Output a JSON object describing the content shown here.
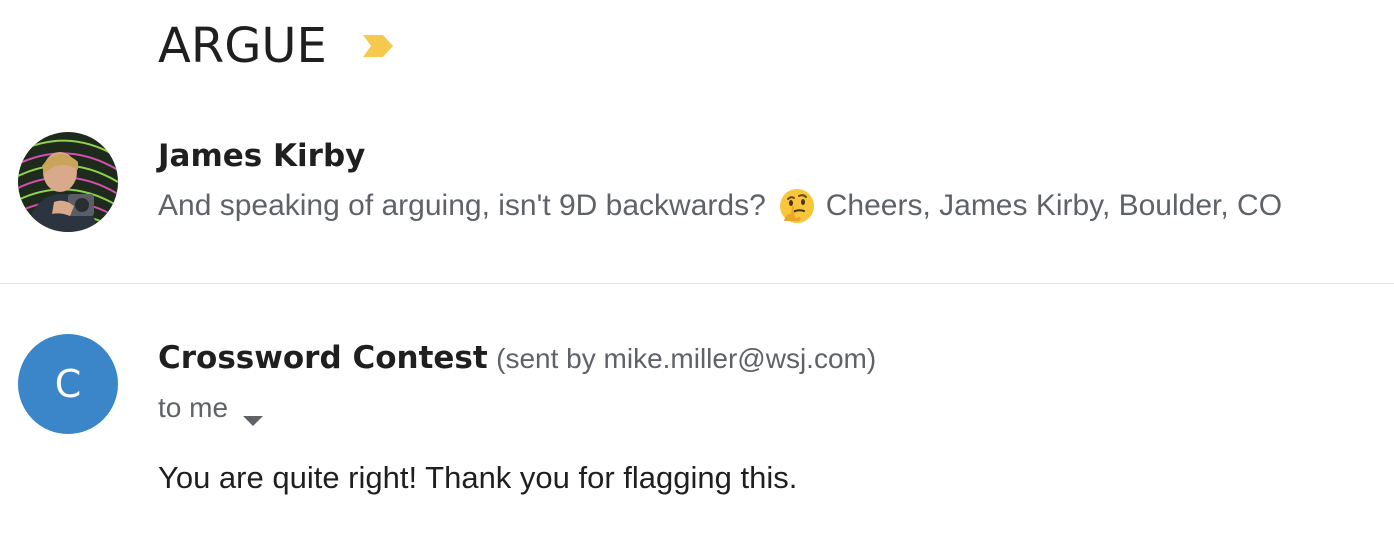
{
  "thread": {
    "subject": "ARGUE",
    "importance_icon": "importance-marker-icon",
    "importance_color": "#f4c94e"
  },
  "messages": [
    {
      "sender": "James Kirby",
      "avatar_icon": "profile-photo",
      "snippet_before_emoji": "And speaking of arguing, isn't 9D backwards?",
      "emoji_icon": "thinking-face-emoji",
      "snippet_after_emoji": "Cheers, James Kirby, Boulder, CO"
    },
    {
      "sender": "Crossword Contest",
      "sent_by": "(sent by mike.miller@wsj.com)",
      "avatar_letter": "C",
      "avatar_color": "#3b86c8",
      "recipient": "to me",
      "recipient_dropdown_icon": "caret-down-icon",
      "body": "You are quite right! Thank you for flagging this."
    }
  ]
}
